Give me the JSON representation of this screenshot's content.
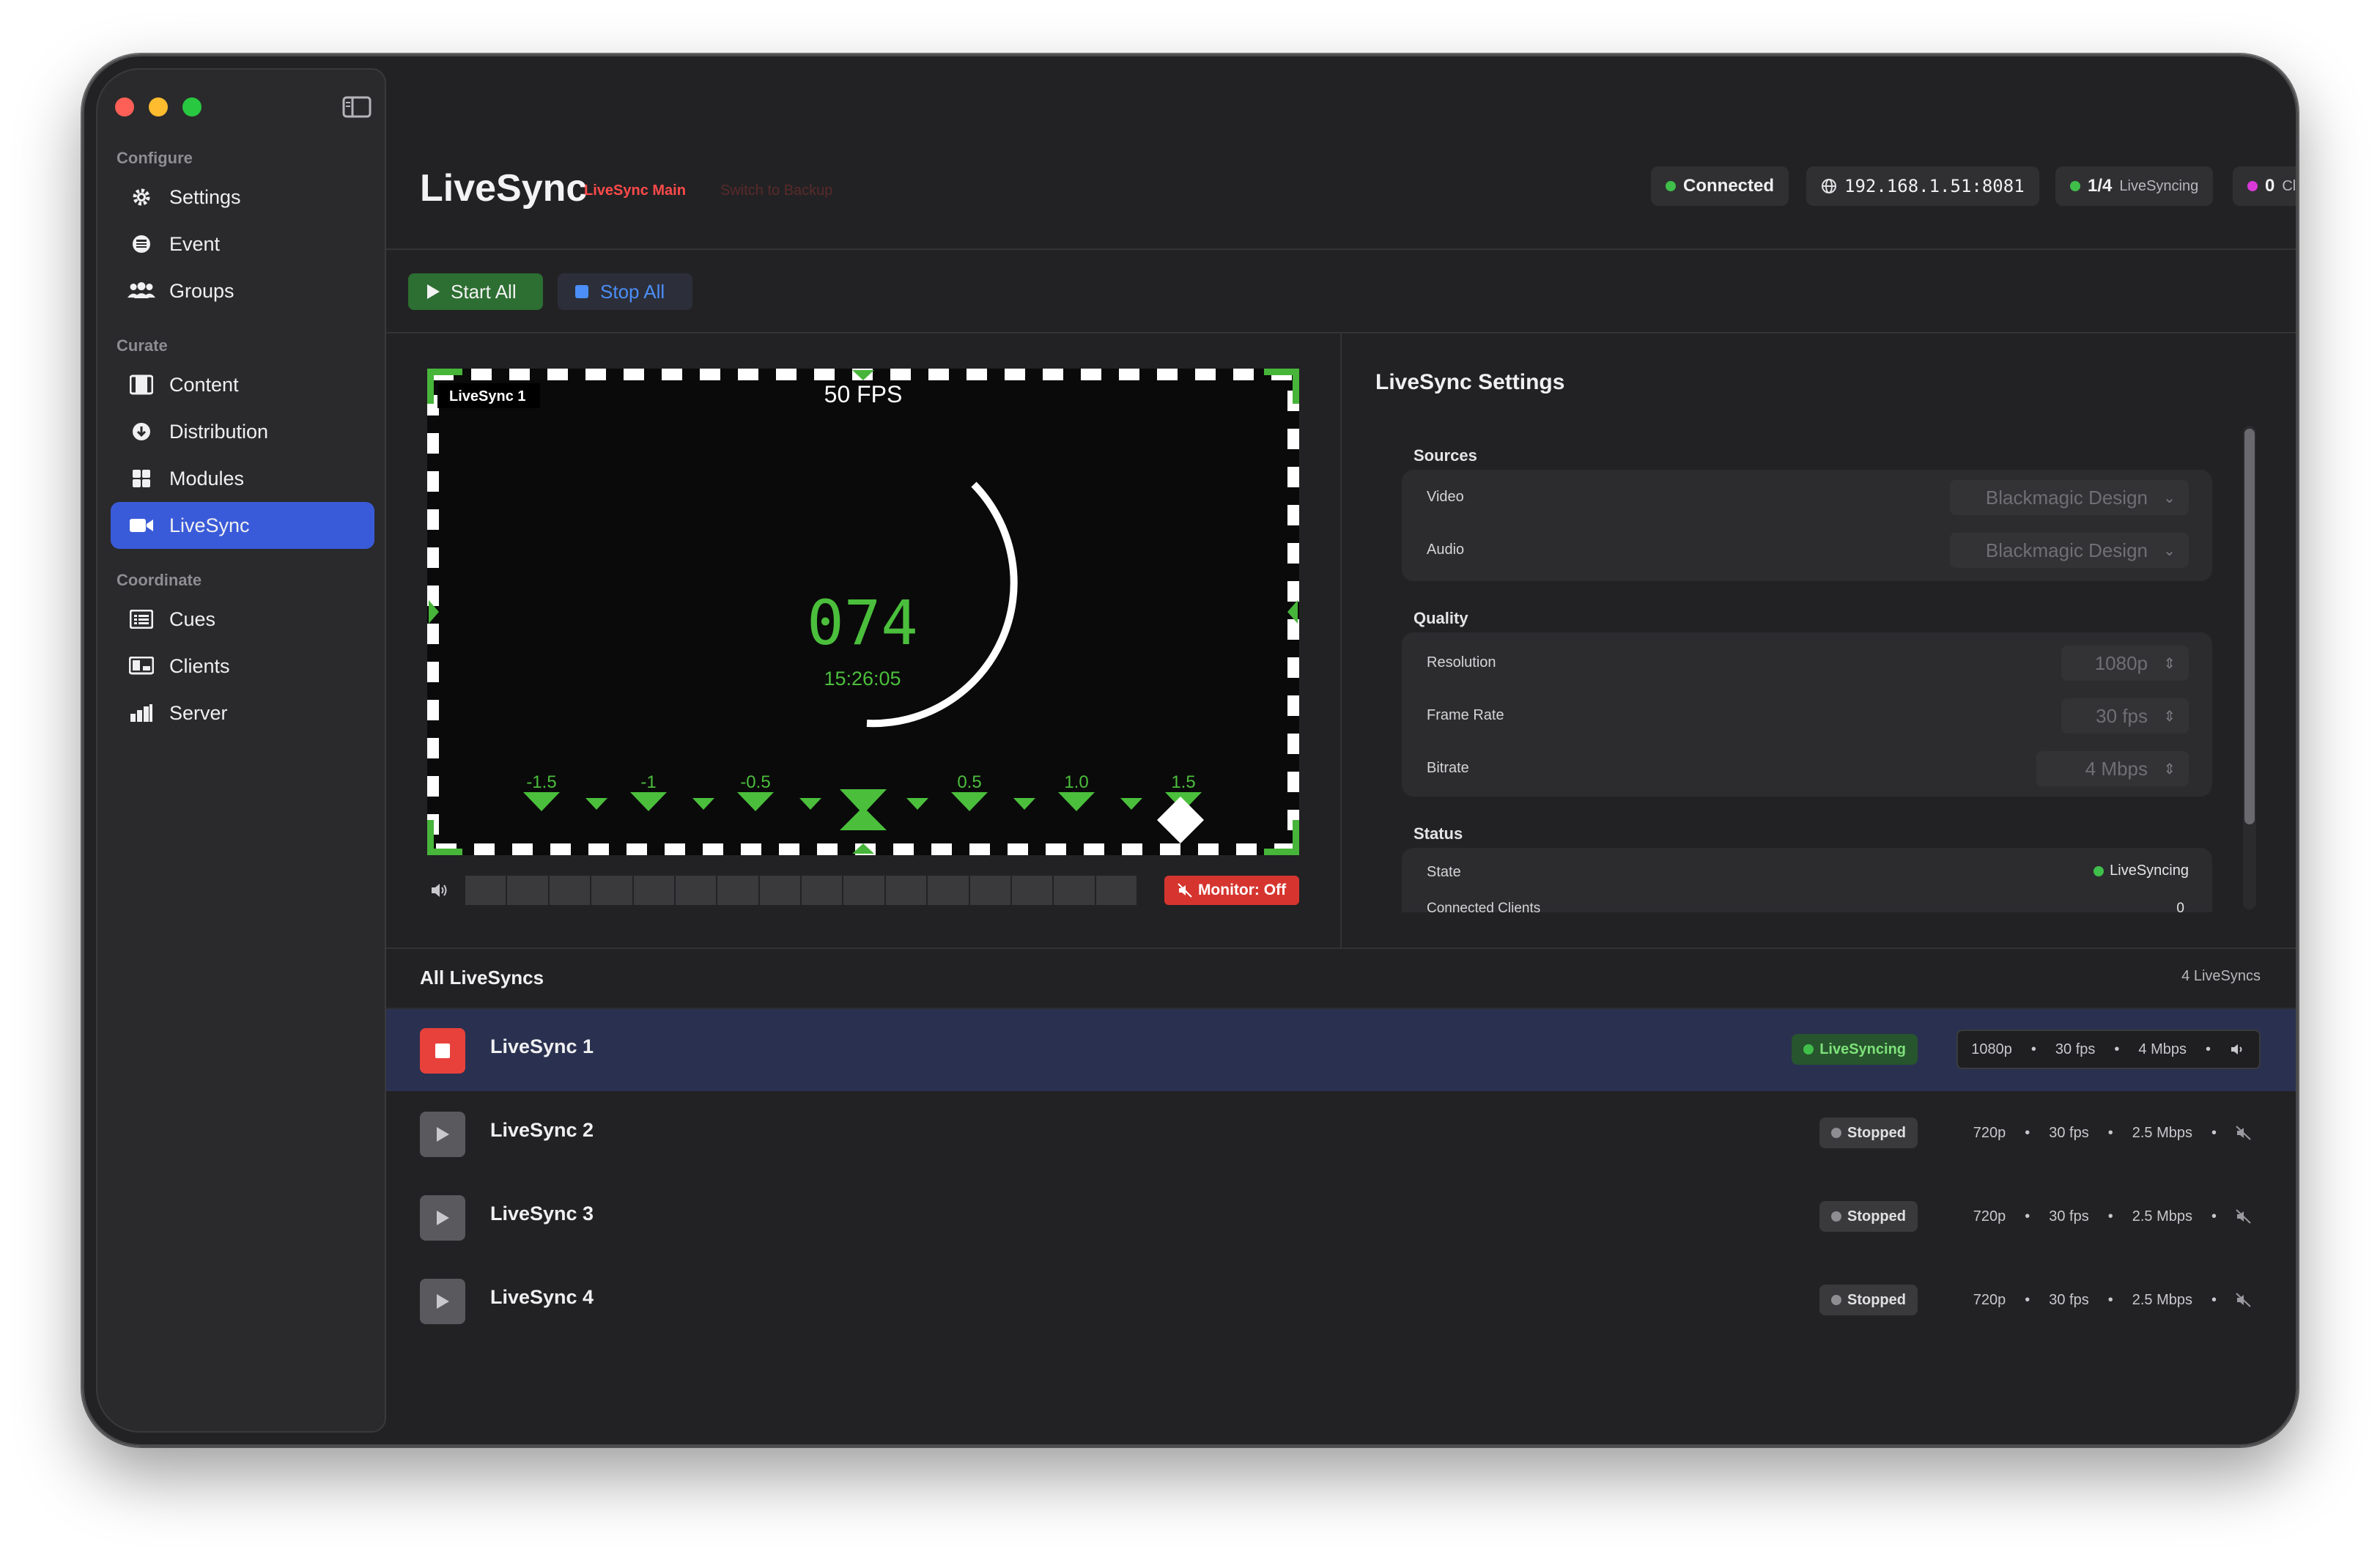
{
  "sidebar": {
    "sections": [
      {
        "label": "Configure",
        "items": [
          {
            "label": "Settings",
            "icon": "gear-icon"
          },
          {
            "label": "Event",
            "icon": "calendar-icon"
          },
          {
            "label": "Groups",
            "icon": "people-icon"
          }
        ]
      },
      {
        "label": "Curate",
        "items": [
          {
            "label": "Content",
            "icon": "film-icon"
          },
          {
            "label": "Distribution",
            "icon": "download-circle-icon"
          },
          {
            "label": "Modules",
            "icon": "grid-icon"
          },
          {
            "label": "LiveSync",
            "icon": "video-camera-icon",
            "active": true
          }
        ]
      },
      {
        "label": "Coordinate",
        "items": [
          {
            "label": "Cues",
            "icon": "list-icon"
          },
          {
            "label": "Clients",
            "icon": "monitor-icon"
          },
          {
            "label": "Server",
            "icon": "bar-chart-icon"
          }
        ]
      }
    ]
  },
  "header": {
    "title": "LiveSync",
    "main_label": "LiveSync Main",
    "backup_label": "Switch to Backup",
    "connection": "Connected",
    "address": "192.168.1.51:8081",
    "sync_count": "1/4",
    "sync_label": "LiveSyncing",
    "clients_count": "0",
    "clients_label": "Clients"
  },
  "toolbar": {
    "start_all": "Start All",
    "stop_all": "Stop All"
  },
  "preview": {
    "label": "LiveSync 1",
    "fps": "50 FPS",
    "frame": "074",
    "time": "15:26:05",
    "ticks": [
      "-1.5",
      "-1",
      "-0.5",
      "0.5",
      "1.0",
      "1.5"
    ],
    "monitor_button": "Monitor: Off"
  },
  "settings": {
    "title": "LiveSync Settings",
    "sources_label": "Sources",
    "video_label": "Video",
    "video_value": "Blackmagic Design",
    "audio_label": "Audio",
    "audio_value": "Blackmagic Design",
    "quality_label": "Quality",
    "resolution_label": "Resolution",
    "resolution_value": "1080p",
    "framerate_label": "Frame Rate",
    "framerate_value": "30 fps",
    "bitrate_label": "Bitrate",
    "bitrate_value": "4 Mbps",
    "status_label": "Status",
    "state_label": "State",
    "state_value": "LiveSyncing",
    "connected_label": "Connected Clients",
    "connected_value": "0"
  },
  "list": {
    "title": "All LiveSyncs",
    "count": "4 LiveSyncs",
    "rows": [
      {
        "name": "LiveSync 1",
        "status": "LiveSyncing",
        "res": "1080p",
        "fps": "30 fps",
        "bitrate": "4 Mbps",
        "running": true
      },
      {
        "name": "LiveSync 2",
        "status": "Stopped",
        "res": "720p",
        "fps": "30 fps",
        "bitrate": "2.5 Mbps",
        "running": false
      },
      {
        "name": "LiveSync 3",
        "status": "Stopped",
        "res": "720p",
        "fps": "30 fps",
        "bitrate": "2.5 Mbps",
        "running": false
      },
      {
        "name": "LiveSync 4",
        "status": "Stopped",
        "res": "720p",
        "fps": "30 fps",
        "bitrate": "2.5 Mbps",
        "running": false
      }
    ]
  },
  "colors": {
    "accent": "#3a5bd9",
    "live_green": "#3fbf4a",
    "stop_red": "#e8413b",
    "clients_magenta": "#d83ad8"
  }
}
